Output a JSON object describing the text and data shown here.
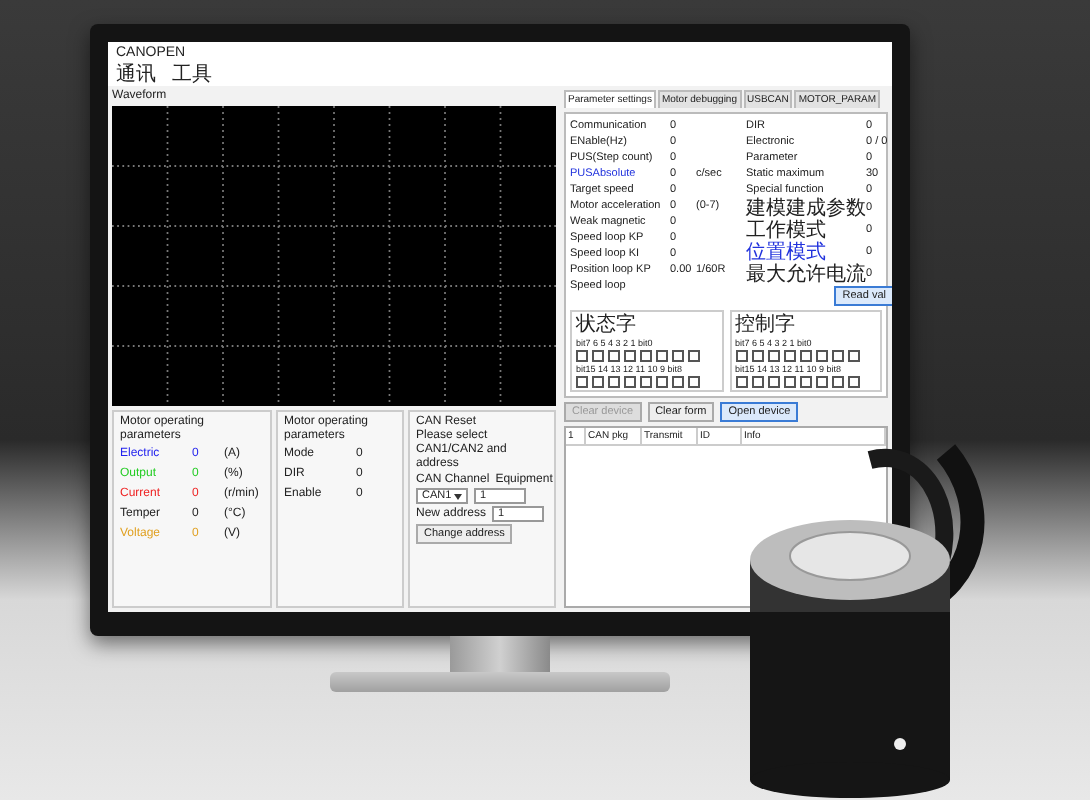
{
  "app": {
    "title": "CANOPEN",
    "menu": [
      "通讯",
      "工具"
    ],
    "waveform_label": "Waveform"
  },
  "tabs": [
    {
      "label": "Parameter settings",
      "selected": true
    },
    {
      "label": "Motor debugging",
      "selected": false
    },
    {
      "label": "USBCAN",
      "selected": false
    },
    {
      "label": "MOTOR_PARAM",
      "selected": false
    }
  ],
  "params_left": [
    {
      "label": "Communication",
      "value": "0"
    },
    {
      "label": "ENable(Hz)",
      "value": "0"
    },
    {
      "label": "PUS(Step count)",
      "value": "0"
    },
    {
      "label": "PUSAbsolute",
      "value": "0",
      "unit": "c/sec",
      "color": "#2233dd"
    },
    {
      "label": "Target speed",
      "value": "0"
    },
    {
      "label": "Motor acceleration",
      "value": "0",
      "unit": "(0-7)"
    },
    {
      "label": "Weak magnetic",
      "value": "0"
    },
    {
      "label": "Speed loop KP",
      "value": "0"
    },
    {
      "label": "Speed loop KI",
      "value": "0"
    },
    {
      "label": "Position loop KP",
      "value": "0.00",
      "unit": "1/60R"
    },
    {
      "label": "Speed loop"
    }
  ],
  "params_right": [
    {
      "label": "DIR",
      "value": "0"
    },
    {
      "label": "Electronic",
      "value": "0 / 0"
    },
    {
      "label": "Parameter",
      "value": "0"
    },
    {
      "label": "Static maximum",
      "value": "30"
    },
    {
      "label": "Special function",
      "value": "0"
    },
    {
      "label": "建模建成参数",
      "value": "0"
    },
    {
      "label": "工作模式",
      "value": "0"
    },
    {
      "label": "位置模式",
      "value": "0",
      "color": "#2233dd"
    },
    {
      "label": "最大允许电流",
      "value": "0"
    }
  ],
  "read_button": "Read val",
  "bit_groups": [
    {
      "title": "状态字",
      "rows": [
        {
          "label": "bit7 6 5 4 3 2 1 bit0",
          "bits": [
            false,
            false,
            false,
            false,
            false,
            false,
            false,
            false
          ]
        },
        {
          "label": "bit15 14 13 12 11 10 9 bit8",
          "bits": [
            false,
            false,
            false,
            false,
            false,
            false,
            false,
            false
          ]
        }
      ]
    },
    {
      "title": "控制字",
      "rows": [
        {
          "label": "bit7 6 5 4 3 2 1 bit0",
          "bits": [
            false,
            false,
            false,
            false,
            false,
            false,
            false,
            false
          ]
        },
        {
          "label": "bit15 14 13 12 11 10 9 bit8",
          "bits": [
            false,
            false,
            false,
            false,
            false,
            false,
            false,
            false
          ]
        }
      ]
    }
  ],
  "buttons": [
    {
      "label": "Clear device",
      "disabled": true,
      "focused": false
    },
    {
      "label": "Clear form",
      "disabled": false,
      "focused": false
    },
    {
      "label": "Open device",
      "disabled": false,
      "focused": true
    }
  ],
  "table": {
    "columns": [
      "1",
      "CAN pkg",
      "Transmit",
      "ID",
      "Info"
    ]
  },
  "motor_params": {
    "title": "Motor operating parameters",
    "rows": [
      {
        "label": "Electric",
        "value": "0",
        "unit": "(A)",
        "color": "#2222ee"
      },
      {
        "label": "Output",
        "value": "0",
        "unit": "(%)",
        "color": "#22cc22"
      },
      {
        "label": "Current",
        "value": "0",
        "unit": "(r/min)",
        "color": "#ee2222"
      },
      {
        "label": "Temper",
        "value": "0",
        "unit": "(°C)",
        "color": "#222222"
      },
      {
        "label": "Voltage",
        "value": "0",
        "unit": "(V)",
        "color": "#e0a020"
      }
    ]
  },
  "motor_state": {
    "title": "Motor operating parameters",
    "rows": [
      {
        "label": "Mode",
        "value": "0"
      },
      {
        "label": "DIR",
        "value": "0"
      },
      {
        "label": "Enable",
        "value": "0"
      }
    ]
  },
  "can_reset": {
    "title": "CAN Reset",
    "hint": "Please select CAN1/CAN2 and address",
    "channel_label": "CAN Channel",
    "channel": "CAN1",
    "equipment_label": "Equipment",
    "equipment": "1",
    "new_address_label": "New address",
    "new_address": "1",
    "button": "Change address"
  }
}
